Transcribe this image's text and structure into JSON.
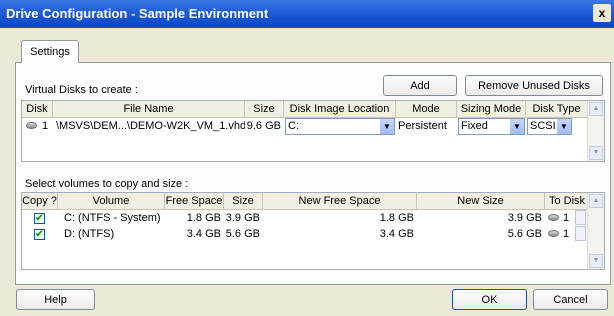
{
  "window": {
    "title": "Drive Configuration - Sample Environment",
    "close_glyph": "x"
  },
  "tabs": [
    {
      "label": "Settings"
    }
  ],
  "virtual_disks": {
    "label": "Virtual Disks to create :",
    "add_label": "Add",
    "remove_label": "Remove Unused Disks",
    "columns": [
      "Disk",
      "File Name",
      "Size",
      "Disk Image Location",
      "Mode",
      "Sizing Mode",
      "Disk Type"
    ],
    "rows": [
      {
        "disk": "1",
        "file_name": "\\MSVS\\DEM...\\DEMO-W2K_VM_1.vhd",
        "size": "9.6 GB",
        "location": "C:",
        "mode": "Persistent",
        "sizing_mode": "Fixed",
        "disk_type": "SCSI"
      }
    ]
  },
  "volumes": {
    "label": "Select volumes to copy and size :",
    "columns": [
      "Copy ?",
      "Volume",
      "Free Space",
      "Size",
      "New Free Space",
      "New Size",
      "To Disk"
    ],
    "rows": [
      {
        "copy": "✔",
        "volume": "C: (NTFS - System)",
        "free_space": "1.8 GB",
        "size": "3.9 GB",
        "new_free_space": "1.8 GB",
        "new_size": "3.9 GB",
        "to_disk": "1"
      },
      {
        "copy": "✔",
        "volume": "D: (NTFS)",
        "free_space": "3.4 GB",
        "size": "5.6 GB",
        "new_free_space": "3.4 GB",
        "new_size": "5.6 GB",
        "to_disk": "1"
      }
    ]
  },
  "footer": {
    "help_label": "Help",
    "ok_label": "OK",
    "cancel_label": "Cancel"
  },
  "glyphs": {
    "dropdown": "▼",
    "up": "▲",
    "down": "▼"
  }
}
